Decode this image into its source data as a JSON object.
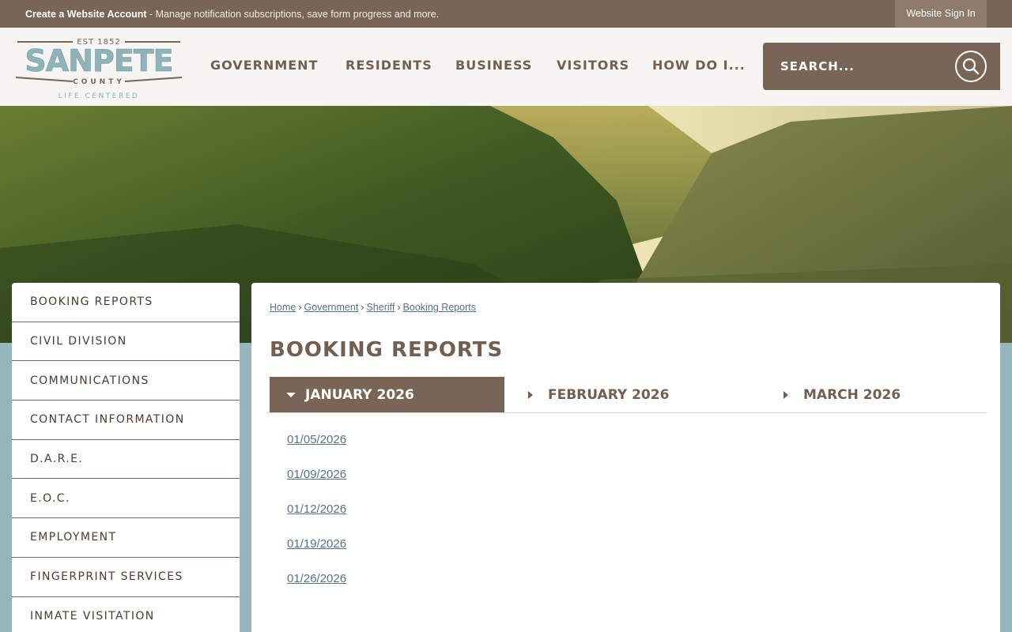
{
  "topbar": {
    "account_link": "Create a Website Account",
    "account_msg": " - Manage notification subscriptions, save form progress and more.",
    "signin": "Website Sign In"
  },
  "logo": {
    "est": "EST 1852",
    "name": "SANPETE",
    "county": "COUNTY",
    "tagline": "LIFE CENTERED"
  },
  "nav": [
    "GOVERNMENT",
    "RESIDENTS",
    "BUSINESS",
    "VISITORS",
    "HOW DO I..."
  ],
  "search": {
    "placeholder": "SEARCH..."
  },
  "sidebar": [
    "BOOKING REPORTS",
    "CIVIL DIVISION",
    "COMMUNICATIONS",
    "CONTACT INFORMATION",
    "D.A.R.E.",
    "E.O.C.",
    "EMPLOYMENT",
    "FINGERPRINT SERVICES",
    "INMATE VISITATION"
  ],
  "breadcrumb": [
    "Home",
    "Government",
    "Sheriff",
    "Booking Reports"
  ],
  "page_title": "BOOKING REPORTS",
  "tabs": [
    "JANUARY 2026",
    "FEBRUARY 2026",
    "MARCH 2026"
  ],
  "reports": [
    "01/05/2026",
    "01/09/2026",
    "01/12/2026",
    "01/19/2026",
    "01/26/2026"
  ],
  "colors": {
    "brand_brown": "#786555",
    "teal_bg": "#93b7bb",
    "link": "#55738a"
  }
}
